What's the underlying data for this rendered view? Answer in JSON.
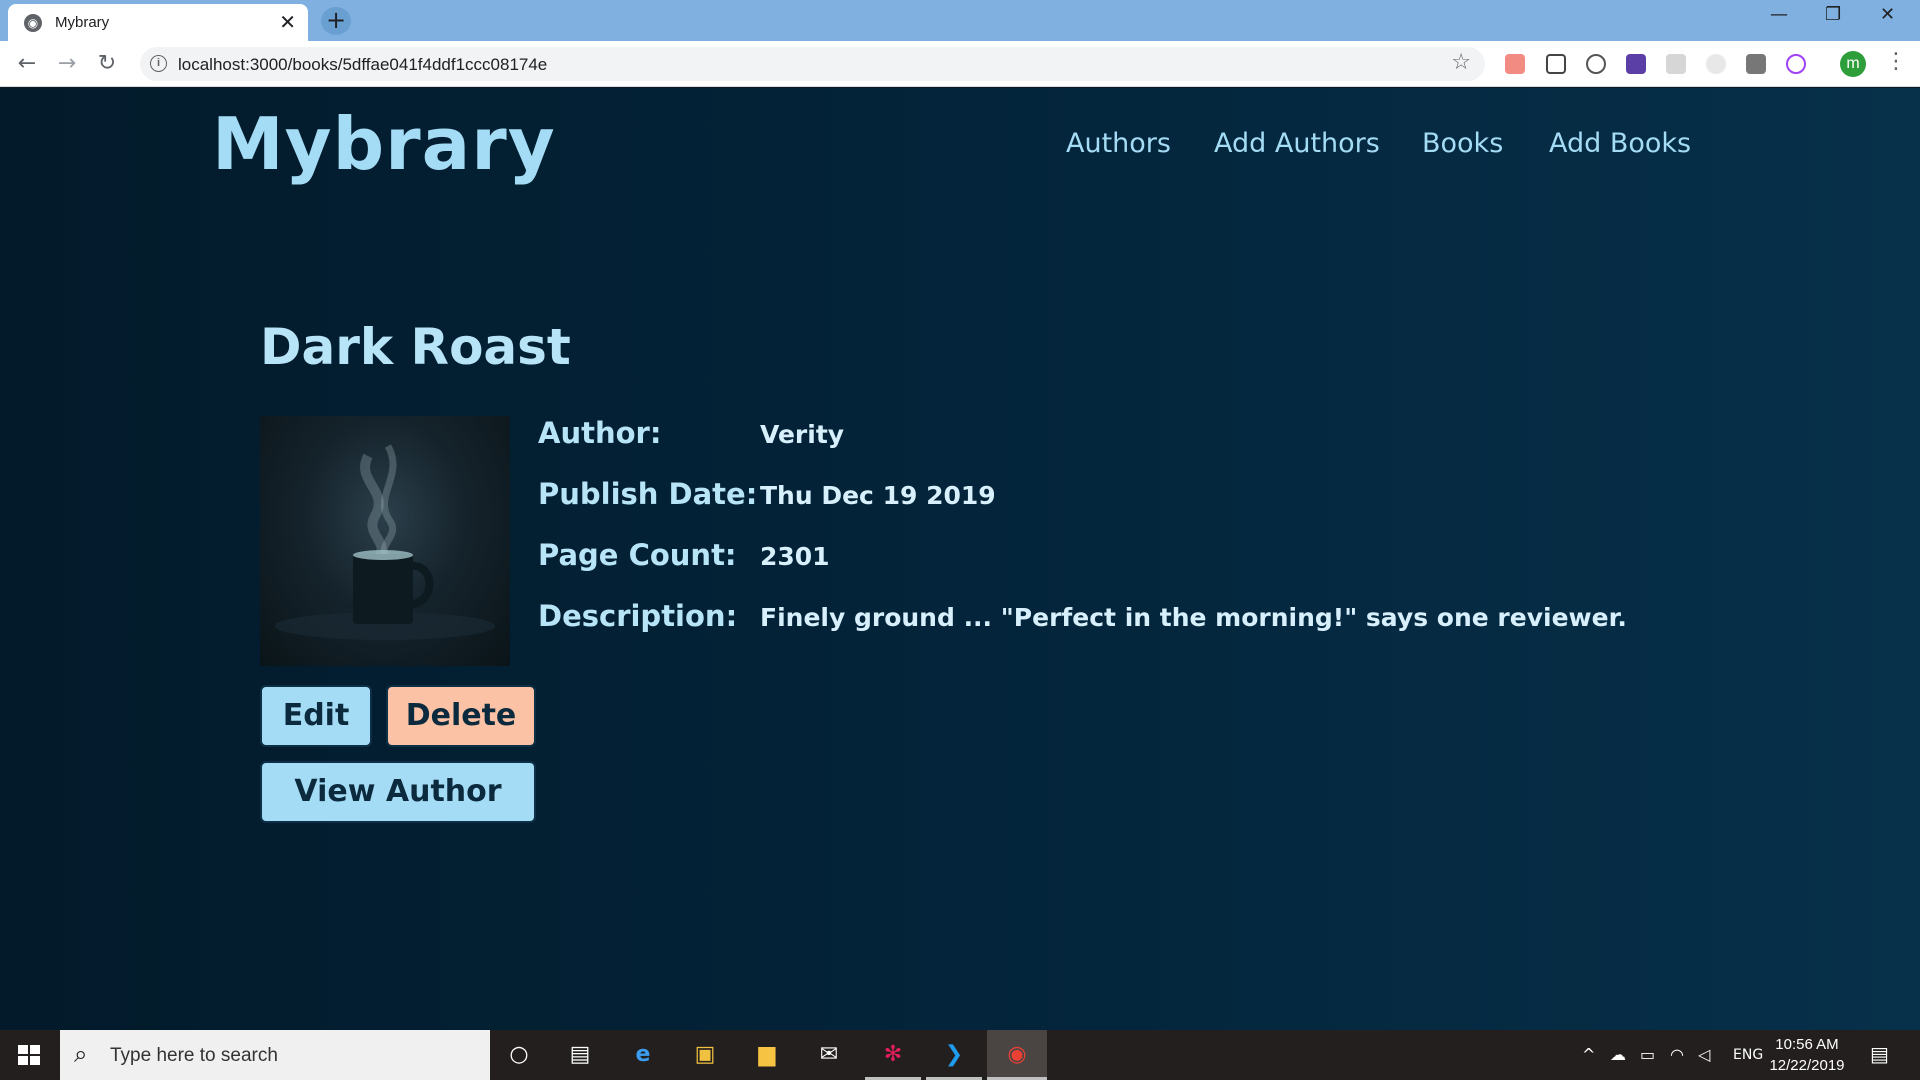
{
  "browser": {
    "tab_title": "Mybrary",
    "url": "localhost:3000/books/5dffae041f4ddf1ccc08174e",
    "profile_initial": "m"
  },
  "site": {
    "brand": "Mybrary",
    "nav": [
      "Authors",
      "Add Authors",
      "Books",
      "Add Books"
    ]
  },
  "book": {
    "title": "Dark Roast",
    "details": [
      {
        "label": "Author:",
        "value": "Verity"
      },
      {
        "label": "Publish Date:",
        "value": "Thu Dec 19 2019"
      },
      {
        "label": "Page Count:",
        "value": "2301"
      },
      {
        "label": "Description:",
        "value": "Finely ground ... \"Perfect in the morning!\" says one reviewer."
      }
    ]
  },
  "actions": {
    "edit": "Edit",
    "delete": "Delete",
    "view_author": "View Author"
  },
  "taskbar": {
    "search_placeholder": "Type here to search",
    "language": "ENG",
    "time": "10:56 AM",
    "date": "12/22/2019"
  },
  "colors": {
    "accent": "#a5dcf5",
    "danger": "#fbc2a6",
    "page_bg": "#03243a"
  },
  "icons": {
    "back": "arrow-left-icon",
    "forward": "arrow-right-icon",
    "reload": "reload-icon",
    "star": "star-icon",
    "menu": "kebab-menu-icon"
  }
}
